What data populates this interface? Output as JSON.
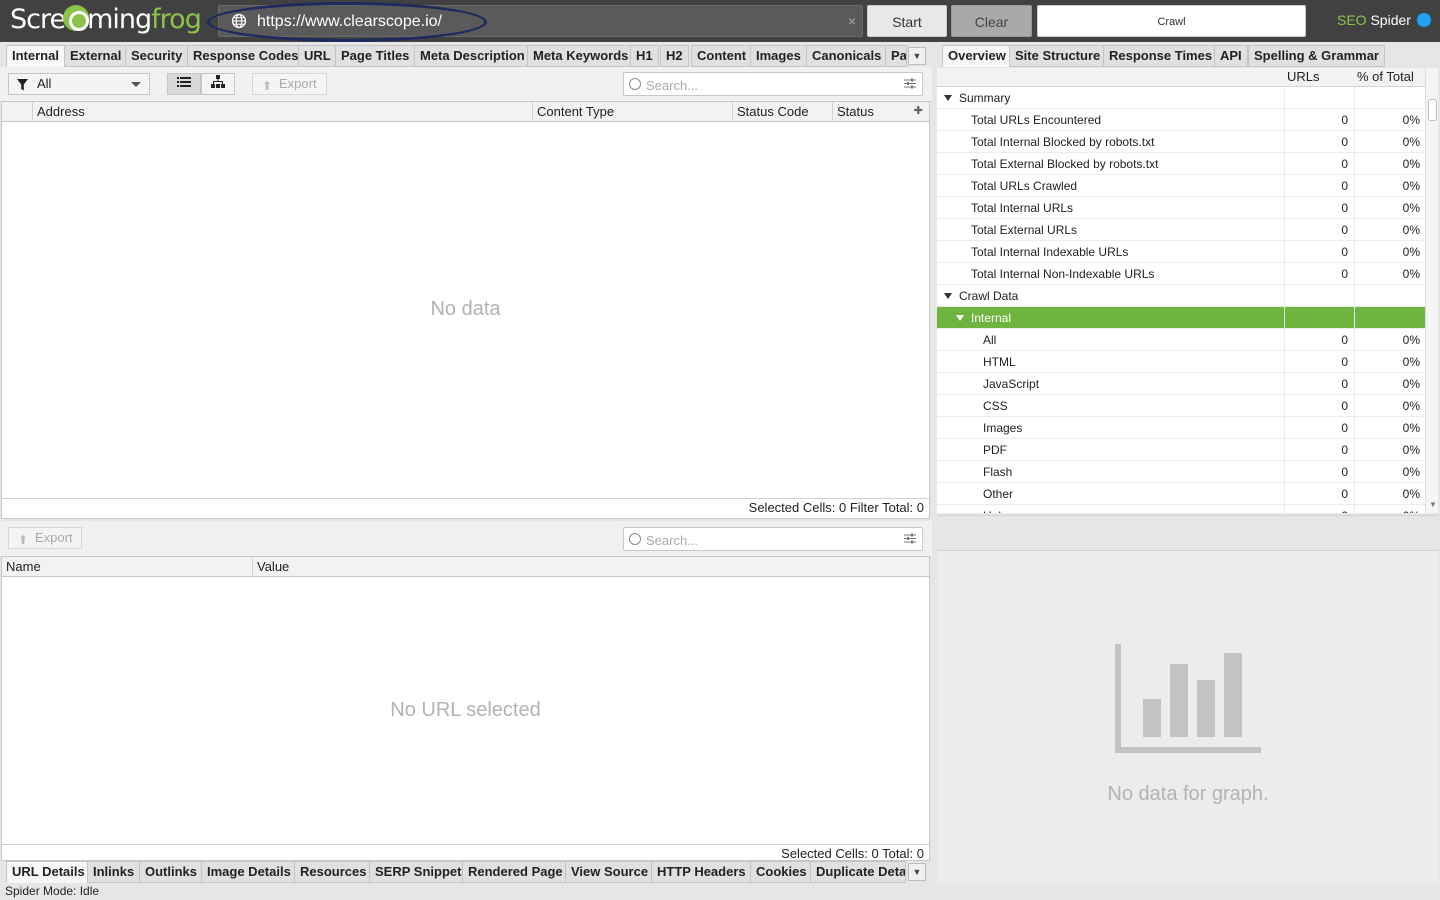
{
  "app": {
    "logo_part1": "Scre",
    "logo_part2": "ming",
    "logo_part3": "frog",
    "brand_seo": "SEO",
    "brand_spider": " Spider"
  },
  "urlbar": {
    "value": "https://www.clearscope.io/",
    "clear_glyph": "×"
  },
  "top_buttons": {
    "start": "Start",
    "clear": "Clear",
    "crawl": "Crawl"
  },
  "left_tabs": [
    "Internal",
    "External",
    "Security",
    "Response Codes",
    "URL",
    "Page Titles",
    "Meta Description",
    "Meta Keywords",
    "H1",
    "H2",
    "Content",
    "Images",
    "Canonicals",
    "Pa"
  ],
  "filter": {
    "selected": "All",
    "export_label": "Export",
    "search_placeholder": "Search..."
  },
  "main_table": {
    "columns": [
      "Address",
      "Content Type",
      "Status Code",
      "Status"
    ],
    "empty_message": "No data",
    "footer": "Selected Cells:  0  Filter Total:  0"
  },
  "lower_panel": {
    "export_label": "Export",
    "search_placeholder": "Search...",
    "columns": [
      "Name",
      "Value"
    ],
    "empty_message": "No URL selected",
    "footer": "Selected Cells:  0  Total:  0"
  },
  "bottom_tabs": [
    "URL Details",
    "Inlinks",
    "Outlinks",
    "Image Details",
    "Resources",
    "SERP Snippet",
    "Rendered Page",
    "View Source",
    "HTTP Headers",
    "Cookies",
    "Duplicate Detai"
  ],
  "right_tabs": [
    "Overview",
    "Site Structure",
    "Response Times",
    "API",
    "Spelling & Grammar"
  ],
  "overview": {
    "col_urls": "URLs",
    "col_pct": "% of Total",
    "rows": [
      {
        "label": "Summary",
        "level": 0,
        "group": true,
        "urls": "",
        "pct": ""
      },
      {
        "label": "Total URLs Encountered",
        "level": 1,
        "urls": "0",
        "pct": "0%"
      },
      {
        "label": "Total Internal Blocked by robots.txt",
        "level": 1,
        "urls": "0",
        "pct": "0%"
      },
      {
        "label": "Total External Blocked by robots.txt",
        "level": 1,
        "urls": "0",
        "pct": "0%"
      },
      {
        "label": "Total URLs Crawled",
        "level": 1,
        "urls": "0",
        "pct": "0%"
      },
      {
        "label": "Total Internal URLs",
        "level": 1,
        "urls": "0",
        "pct": "0%"
      },
      {
        "label": "Total External URLs",
        "level": 1,
        "urls": "0",
        "pct": "0%"
      },
      {
        "label": "Total Internal Indexable URLs",
        "level": 1,
        "urls": "0",
        "pct": "0%"
      },
      {
        "label": "Total Internal Non-Indexable URLs",
        "level": 1,
        "urls": "0",
        "pct": "0%"
      },
      {
        "label": "Crawl Data",
        "level": 0,
        "group": true,
        "urls": "",
        "pct": ""
      },
      {
        "label": "Internal",
        "level": 1,
        "group": true,
        "selected": true,
        "urls": "",
        "pct": ""
      },
      {
        "label": "All",
        "level": 2,
        "urls": "0",
        "pct": "0%"
      },
      {
        "label": "HTML",
        "level": 2,
        "urls": "0",
        "pct": "0%"
      },
      {
        "label": "JavaScript",
        "level": 2,
        "urls": "0",
        "pct": "0%"
      },
      {
        "label": "CSS",
        "level": 2,
        "urls": "0",
        "pct": "0%"
      },
      {
        "label": "Images",
        "level": 2,
        "urls": "0",
        "pct": "0%"
      },
      {
        "label": "PDF",
        "level": 2,
        "urls": "0",
        "pct": "0%"
      },
      {
        "label": "Flash",
        "level": 2,
        "urls": "0",
        "pct": "0%"
      },
      {
        "label": "Other",
        "level": 2,
        "urls": "0",
        "pct": "0%"
      },
      {
        "label": "Unknown",
        "level": 2,
        "urls": "0",
        "pct": "0%"
      }
    ]
  },
  "graph": {
    "empty_message": "No data for graph.",
    "icon": "bar-chart-icon"
  },
  "statusbar": {
    "text": "Spider Mode: Idle"
  },
  "colors": {
    "accent_green": "#6fb43e",
    "topbar": "#414141",
    "brand_green": "#8bc34a"
  }
}
